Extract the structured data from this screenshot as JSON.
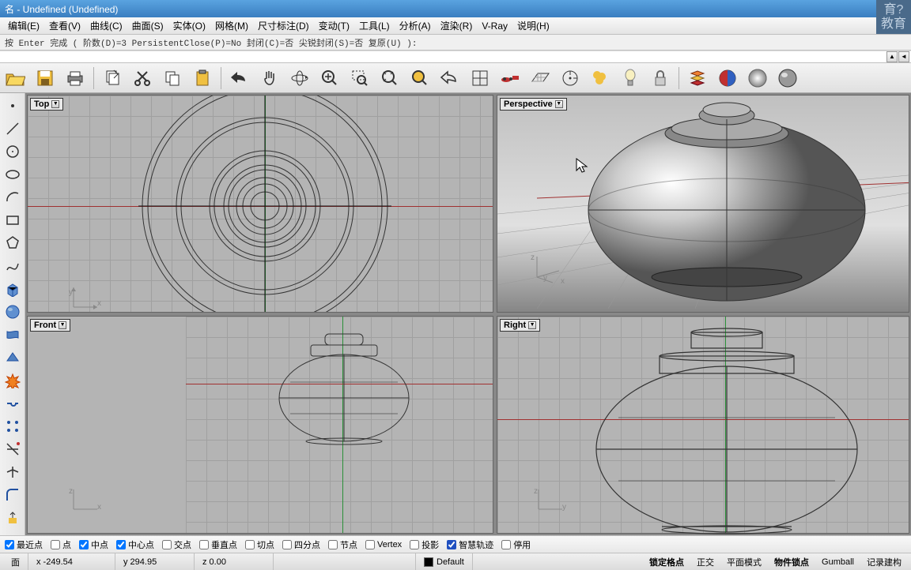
{
  "title": "名 - Undefined (Undefined)",
  "watermark": {
    "line1": "育?",
    "line2": "教育"
  },
  "menus": [
    {
      "label": "编辑(E)"
    },
    {
      "label": "查看(V)"
    },
    {
      "label": "曲线(C)"
    },
    {
      "label": "曲面(S)"
    },
    {
      "label": "实体(O)"
    },
    {
      "label": "网格(M)"
    },
    {
      "label": "尺寸标注(D)"
    },
    {
      "label": "变动(T)"
    },
    {
      "label": "工具(L)"
    },
    {
      "label": "分析(A)"
    },
    {
      "label": "渲染(R)"
    },
    {
      "label": "V-Ray"
    },
    {
      "label": "说明(H)"
    }
  ],
  "command": "按 Enter 完成 ( 阶数(D)=3  PersistentClose(P)=No  封闭(C)=否  尖锐封闭(S)=否  复原(U) ):",
  "viewports": {
    "top": "Top",
    "perspective": "Perspective",
    "front": "Front",
    "right": "Right",
    "axes": {
      "x": "x",
      "y": "y",
      "z": "z"
    }
  },
  "osnap": {
    "items": [
      {
        "label": "最近点",
        "checked": true
      },
      {
        "label": "点",
        "checked": false
      },
      {
        "label": "中点",
        "checked": true
      },
      {
        "label": "中心点",
        "checked": true
      },
      {
        "label": "交点",
        "checked": false
      },
      {
        "label": "垂直点",
        "checked": false
      },
      {
        "label": "切点",
        "checked": false
      },
      {
        "label": "四分点",
        "checked": false
      },
      {
        "label": "节点",
        "checked": false
      },
      {
        "label": "Vertex",
        "checked": false
      },
      {
        "label": "投影",
        "checked": false
      },
      {
        "label": "智慧轨迹",
        "checked": true
      },
      {
        "label": "停用",
        "checked": false
      }
    ]
  },
  "status": {
    "pane0": "面",
    "coord_x": "x -249.54",
    "coord_y": "y 294.95",
    "coord_z": "z 0.00",
    "layer": "Default",
    "toggles": [
      {
        "label": "锁定格点",
        "bold": true
      },
      {
        "label": "正交",
        "bold": false
      },
      {
        "label": "平面模式",
        "bold": false
      },
      {
        "label": "物件锁点",
        "bold": true
      },
      {
        "label": "Gumball",
        "bold": false
      },
      {
        "label": "记录建构",
        "bold": false
      }
    ]
  }
}
